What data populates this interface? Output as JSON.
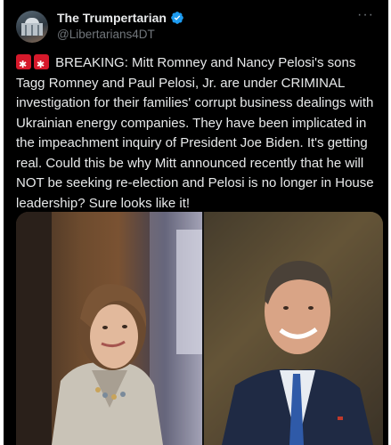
{
  "tweet": {
    "display_name": "The Trumpertarian",
    "handle": "@Libertarians4DT",
    "more_label": "···",
    "body": "BREAKING: Mitt Romney and Nancy Pelosi's sons Tagg Romney and Paul Pelosi, Jr. are under CRIMINAL investigation for their families' corrupt business dealings with Ukrainian energy companies. They have been implicated in the impeachment inquiry of President Joe Biden. It's getting real. Could this be why Mitt announced recently that he will NOT be seeking re-election and Pelosi is no longer in House leadership? Sure looks like it!"
  },
  "icons": {
    "verified": "verified-badge-icon",
    "siren": "police-light-emoji",
    "more": "more-options-icon"
  },
  "colors": {
    "background": "#000000",
    "text": "#e7e9ea",
    "muted": "#71767b",
    "verified": "#1d9bf0",
    "siren": "#d6192b"
  }
}
